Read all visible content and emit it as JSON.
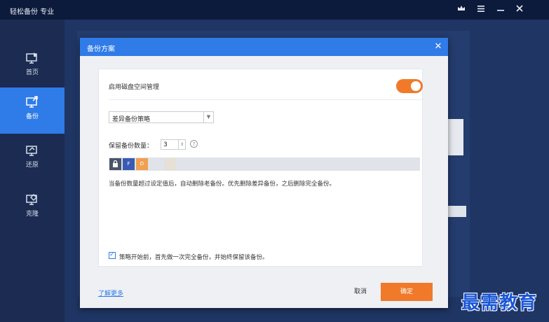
{
  "app": {
    "title": "轻松备份 专业",
    "title_icons": [
      "crown-icon",
      "menu-icon",
      "minimize-icon",
      "close-icon"
    ]
  },
  "sidebar": {
    "items": [
      {
        "label": "首页",
        "icon": "home-monitor-icon",
        "active": false
      },
      {
        "label": "备份",
        "icon": "backup-monitor-icon",
        "active": true
      },
      {
        "label": "还原",
        "icon": "restore-monitor-icon",
        "active": false
      },
      {
        "label": "克隆",
        "icon": "clone-monitor-icon",
        "active": false
      }
    ]
  },
  "dialog": {
    "title": "备份方案",
    "enable_disk_label": "启用磁盘空间管理",
    "toggle_on": true,
    "strategy_select": "差异备份策略",
    "keep_count_label": "保留备份数量：",
    "keep_count_value": "3",
    "bar_blocks": [
      {
        "label": "",
        "icon": "lock-icon",
        "color": "#4a5568"
      },
      {
        "label": "F",
        "color": "#3b5bb3"
      },
      {
        "label": "D",
        "color": "#f0a050"
      }
    ],
    "note": "当备份数量超过设定值后，自动删除老备份。优先删除差异备份，之后删除完全备份。",
    "checkbox_label": "策略开始前，首先做一次完全备份，并始终保留该备份。",
    "checkbox_checked": true,
    "learn_more": "了解更多",
    "cancel": "取消",
    "ok": "确定"
  },
  "colors": {
    "accent": "#2f7be8",
    "orange": "#f07a2a",
    "sidebar_bg": "#1c2b52",
    "titlebar_bg": "#0c1a3c"
  },
  "watermark": "最需教育"
}
